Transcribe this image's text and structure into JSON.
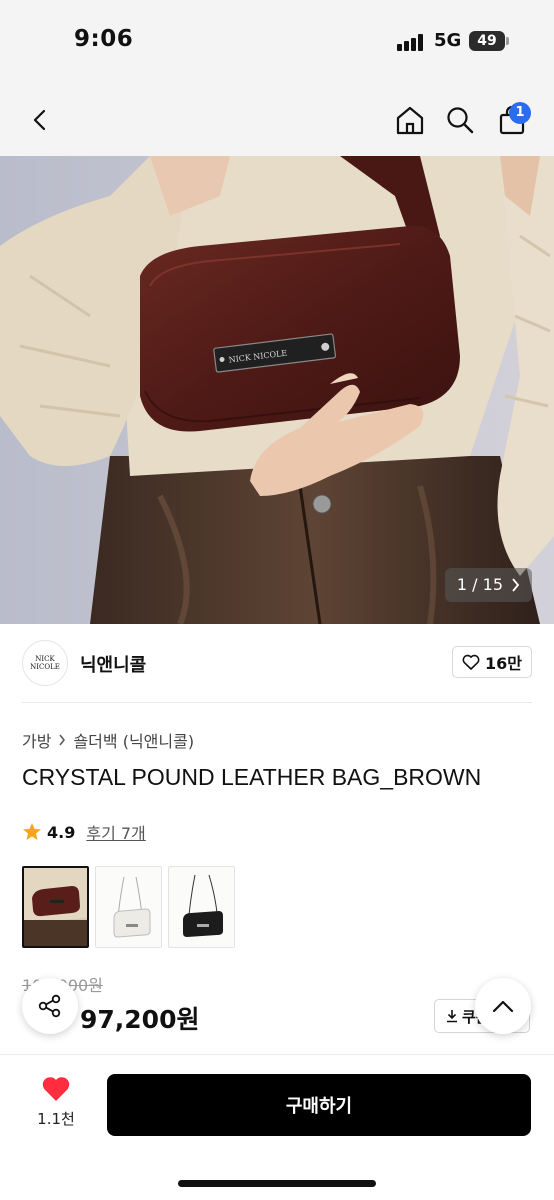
{
  "status_bar": {
    "time": "9:06",
    "network": "5G",
    "battery": "49"
  },
  "nav": {
    "cart_count": "1"
  },
  "hero": {
    "page_indicator": "1 / 15",
    "bag_plate_text": "NICK NICOLE"
  },
  "brand": {
    "logo_line1": "NICK",
    "logo_line2": "NICOLE",
    "name": "닉앤니콜",
    "likes": "16만"
  },
  "breadcrumb": {
    "category": "가방",
    "subcategory": "숄더백 (닉앤니콜)"
  },
  "product": {
    "title": "CRYSTAL POUND LEATHER BAG_BROWN",
    "rating": "4.9",
    "reviews": "후기 7개",
    "original_price": "108,000원",
    "price": "97,200원",
    "coupon_label": "쿠폰"
  },
  "thumbnails": [
    {
      "name": "brown",
      "color": "#5a1e1a"
    },
    {
      "name": "white",
      "color": "#ecebe6"
    },
    {
      "name": "black",
      "color": "#1c1c1c"
    }
  ],
  "bottom_bar": {
    "wish_count": "1.1천",
    "buy_label": "구매하기"
  },
  "colors": {
    "heart": "#ff2d3d",
    "badge": "#2b6cf0",
    "bag": "#5a1e1a",
    "sweater": "#e7dcc8"
  }
}
